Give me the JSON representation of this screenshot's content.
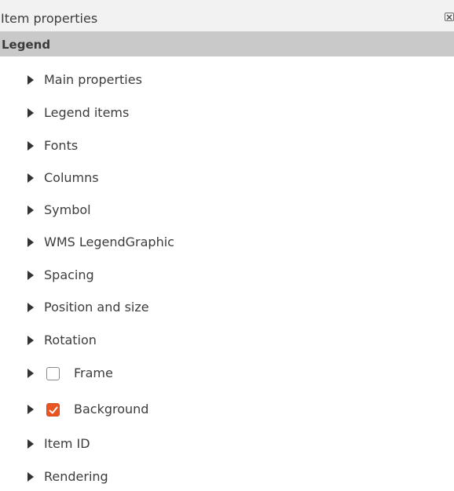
{
  "dock": {
    "title": "Item properties",
    "close_icon": "close-icon"
  },
  "section": {
    "title": "Legend"
  },
  "groups": [
    {
      "label": "Main properties",
      "checkable": false
    },
    {
      "label": "Legend items",
      "checkable": false
    },
    {
      "label": "Fonts",
      "checkable": false
    },
    {
      "label": "Columns",
      "checkable": false
    },
    {
      "label": "Symbol",
      "checkable": false
    },
    {
      "label": "WMS LegendGraphic",
      "checkable": false
    },
    {
      "label": "Spacing",
      "checkable": false
    },
    {
      "label": "Position and size",
      "checkable": false
    },
    {
      "label": "Rotation",
      "checkable": false
    },
    {
      "label": "Frame",
      "checkable": true,
      "checked": false
    },
    {
      "label": "Background",
      "checkable": true,
      "checked": true
    },
    {
      "label": "Item ID",
      "checkable": false
    },
    {
      "label": "Rendering",
      "checkable": false
    }
  ],
  "colors": {
    "accent": "#e95420",
    "header_bg": "#c9c9c9",
    "titlebar_bg": "#f2f2f2",
    "text": "#3c3c3c"
  },
  "icons": {
    "collapsed_group": "triangle-right-icon",
    "check": "checkmark-icon"
  }
}
